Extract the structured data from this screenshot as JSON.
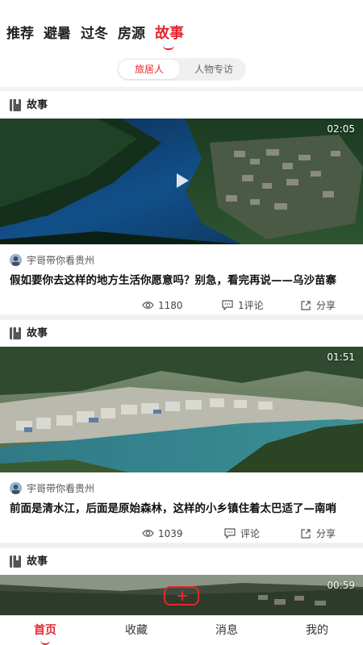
{
  "top_tabs": [
    "推荐",
    "避暑",
    "过冬",
    "房源",
    "故事"
  ],
  "active_top_tab": "故事",
  "sub_tabs": [
    "旅居人",
    "人物专访"
  ],
  "cards": [
    {
      "section_label": "故事",
      "duration": "02:05",
      "author": "宇哥带你看贵州",
      "title": "假如要你去这样的地方生活你愿意吗？别急，看完再说——乌沙苗寨",
      "views": "1180",
      "comments": "1评论",
      "share": "分享"
    },
    {
      "section_label": "故事",
      "duration": "01:51",
      "author": "宇哥带你看贵州",
      "title": "前面是清水江，后面是原始森林，这样的小乡镇住着太巴适了—南哨",
      "views": "1039",
      "comments": "评论",
      "share": "分享"
    },
    {
      "section_label": "故事",
      "duration": "00:59"
    }
  ],
  "bottom_nav": [
    "首页",
    "收藏",
    "消息",
    "我的"
  ],
  "colors": {
    "accent": "#e8262d",
    "separator": "#f1f1f1"
  }
}
